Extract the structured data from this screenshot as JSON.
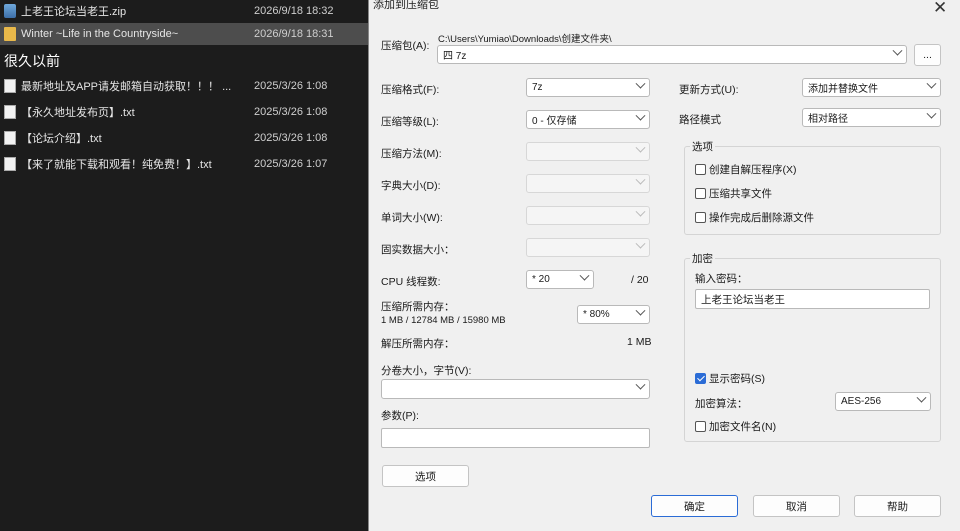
{
  "explorer": {
    "rows": [
      {
        "name": "上老王论坛当老王.zip",
        "date": "2026/9/18 18:32",
        "icon": "zip-archive-icon",
        "selected": false
      },
      {
        "name": "Winter ~Life in the Countryside~",
        "date": "2026/9/18 18:31",
        "icon": "folder-icon",
        "selected": true
      }
    ],
    "group_label": "很久以前",
    "old_rows": [
      {
        "name": "最新地址及APP请发邮箱自动获取！！！ ...",
        "date": "2025/3/26 1:08",
        "icon": "text-file-icon"
      },
      {
        "name": "【永久地址发布页】.txt",
        "date": "2025/3/26 1:08",
        "icon": "text-file-icon"
      },
      {
        "name": "【论坛介绍】.txt",
        "date": "2025/3/26 1:08",
        "icon": "text-file-icon"
      },
      {
        "name": "【来了就能下载和观看！纯免费！】.txt",
        "date": "2025/3/26 1:07",
        "icon": "text-file-icon"
      }
    ]
  },
  "dialog": {
    "title": "添加到压缩包",
    "archive_label": "压缩包(A):",
    "archive_path": "C:\\Users\\Yumiao\\Downloads\\创建文件夹\\",
    "archive_name": "四 7z",
    "browse_label": "...",
    "format_label": "压缩格式(F):",
    "format_value": "7z",
    "level_label": "压缩等级(L):",
    "level_value": "0 - 仅存储",
    "method_label": "压缩方法(M):",
    "dict_label": "字典大小(D):",
    "word_label": "单词大小(W):",
    "solid_label": "固实数据大小：",
    "threads_label": "CPU 线程数:",
    "threads_value": "* 20",
    "threads_total": "/ 20",
    "memcomp_label": "压缩所需内存：",
    "memcomp_detail": "1 MB / 12784 MB / 15980 MB",
    "memcomp_value": "* 80%",
    "memdecomp_label": "解压所需内存：",
    "memdecomp_value": "1 MB",
    "split_label": "分卷大小，字节(V):",
    "params_label": "参数(P):",
    "options_button": "选项",
    "update_label": "更新方式(U):",
    "update_value": "添加并替换文件",
    "pathmode_label": "路径模式",
    "pathmode_value": "相对路径",
    "options_group": "选项",
    "opt_sfx": "创建自解压程序(X)",
    "opt_shared": "压缩共享文件",
    "opt_delete": "操作完成后删除源文件",
    "encrypt_group": "加密",
    "password_label": "输入密码：",
    "password_value": "上老王论坛当老王",
    "show_password": "显示密码(S)",
    "enc_method_label": "加密算法：",
    "enc_method_value": "AES-256",
    "encrypt_names": "加密文件名(N)",
    "ok": "确定",
    "cancel": "取消",
    "help": "帮助"
  }
}
